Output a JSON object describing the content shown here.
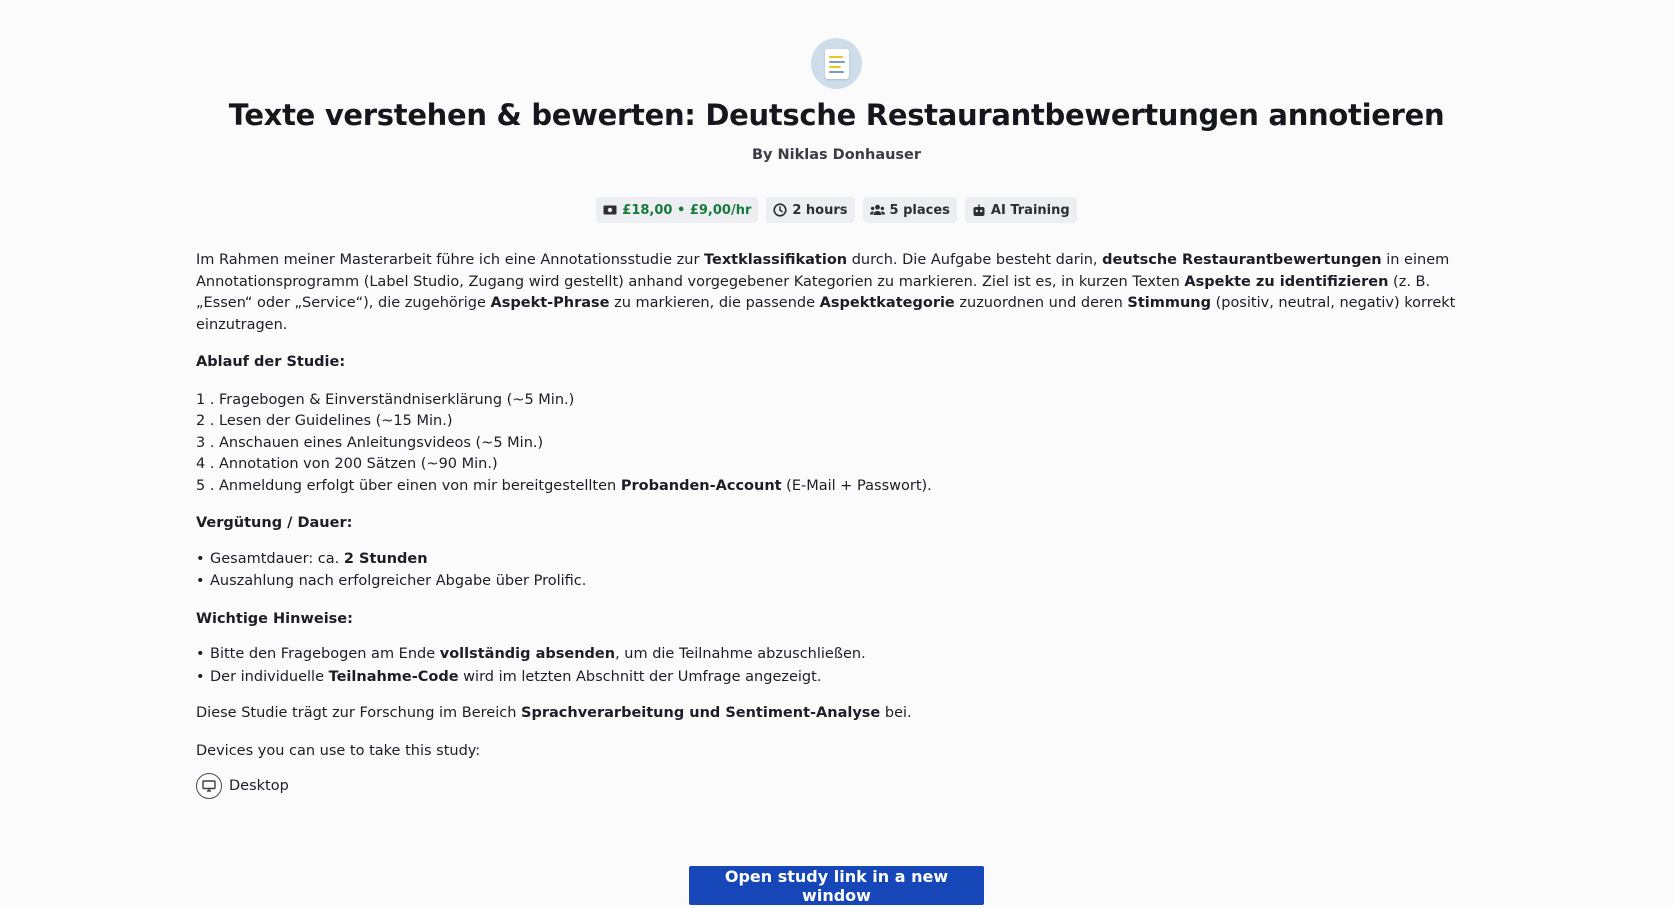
{
  "study": {
    "icon": "document-notes-icon",
    "title": "Texte verstehen & bewerten: Deutsche Restaurantbewertungen annotieren",
    "author": "By Niklas Donhauser"
  },
  "tags": {
    "reward": "£18,00 • £9,00/hr",
    "duration": "2 hours",
    "places": "5 places",
    "category": "AI Training"
  },
  "description": {
    "intro": {
      "t1": "Im Rahmen meiner Masterarbeit führe ich eine Annotationsstudie zur ",
      "b1": "Textklassifikation",
      "t2": " durch. Die Aufgabe besteht darin, ",
      "b2": "deutsche Restaurantbewertungen",
      "t3": " in einem Annotationsprogramm (Label Studio, Zugang wird gestellt) anhand vorgegebener Kategorien zu markieren. Ziel ist es, in kurzen Texten ",
      "b3": "Aspekte zu identifizieren",
      "t4": " (z. B. „Essen“ oder „Service“), die zugehörige ",
      "b4": "Aspekt-Phrase",
      "t5": " zu markieren, die passende ",
      "b5": "Aspektkategorie",
      "t6": " zuzuordnen und deren ",
      "b6": "Stimmung",
      "t7": " (positiv, neutral, negativ) korrekt einzutragen."
    },
    "procedure_heading": "Ablauf der Studie:",
    "procedure": {
      "item1": {
        "num": "1 .",
        "text": "Fragebogen & Einverständniserklärung (~5 Min.)"
      },
      "item2": {
        "num": "2 .",
        "text": "Lesen der Guidelines (~15 Min.)"
      },
      "item3": {
        "num": "3 .",
        "text": "Anschauen eines Anleitungsvideos (~5 Min.)"
      },
      "item4": {
        "num": "4 .",
        "text": "Annotation von 200 Sätzen (~90 Min.)"
      },
      "item5": {
        "num": "5 .",
        "t1": "Anmeldung erfolgt über einen von mir bereitgestellten ",
        "b1": "Probanden-Account",
        "t2": " (E-Mail + Passwort)."
      }
    },
    "compensation_heading": "Vergütung / Dauer:",
    "compensation": {
      "item1": {
        "t1": "Gesamtdauer: ca. ",
        "b1": "2 Stunden"
      },
      "item2": {
        "t1": "Auszahlung nach erfolgreicher Abgabe über Prolific."
      }
    },
    "notes_heading": "Wichtige Hinweise:",
    "notes": {
      "item1": {
        "t1": "Bitte den Fragebogen am Ende ",
        "b1": "vollständig absenden",
        "t2": ", um die Teilnahme abzuschließen."
      },
      "item2": {
        "t1": "Der individuelle ",
        "b1": "Teilnahme-Code",
        "t2": " wird im letzten Abschnitt der Umfrage angezeigt."
      }
    },
    "closing": {
      "t1": "Diese Studie trägt zur Forschung im Bereich ",
      "b1": "Sprachverarbeitung und Sentiment-Analyse",
      "t2": " bei."
    }
  },
  "devices": {
    "label": "Devices you can use to take this study:",
    "items": [
      {
        "icon": "monitor-icon",
        "label": "Desktop"
      }
    ]
  },
  "actions": {
    "open_study": "Open study link in a new window"
  },
  "colors": {
    "primary_button": "#1646b8",
    "reward_text": "#177a3a",
    "tag_background": "#eceef1"
  }
}
